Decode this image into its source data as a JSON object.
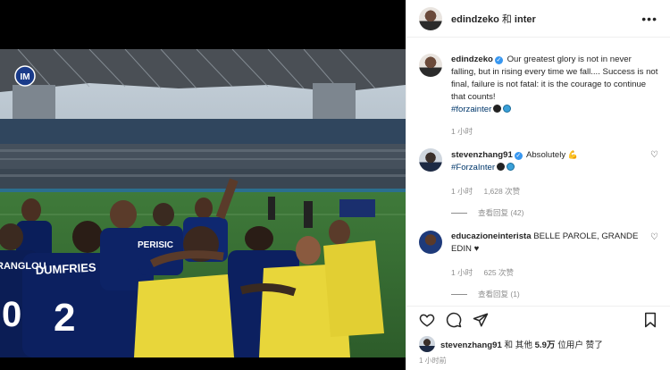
{
  "header": {
    "user": "edindzeko",
    "conj": "和",
    "collab": "inter"
  },
  "caption": {
    "user": "edindzeko",
    "text": "Our greatest glory is not in never falling, but in rising every time we fall.... Success is not final, failure is not fatal: it is the courage to continue that counts!",
    "hashtag": "#forzainter",
    "time": "1 小时"
  },
  "comments": [
    {
      "user": "stevenzhang91",
      "text": "Absolutely",
      "hashtag": "#ForzaInter",
      "time": "1 小时",
      "likes": "1,628 次赞",
      "replies": "查看回复 (42)"
    },
    {
      "user": "educazioneinterista",
      "text": "BELLE PAROLE, GRANDE EDIN ♥",
      "time": "1 小时",
      "likes": "625 次赞",
      "replies": "查看回复 (1)"
    }
  ],
  "likes": {
    "user": "stevenzhang91",
    "mid": "和 其他",
    "count": "5.9万",
    "suffix": "位用户 赞了"
  },
  "post_time": "1 小时前",
  "photo": {
    "jersey_name": "DUMFRIES",
    "jersey_number": "2",
    "jersey_partial": "RANGLOU",
    "jersey_number_left": "0",
    "jersey_partial2": "PERISIC"
  },
  "colors": {
    "accent": "#3897f0",
    "inter_blue": "#0a1e5a",
    "bib_yellow": "#e8d63a"
  }
}
